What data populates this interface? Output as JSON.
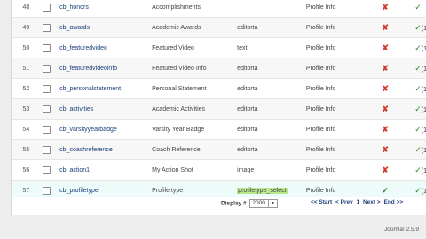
{
  "rows": [
    {
      "id": "48",
      "name": "cb_honors",
      "title": "Accomplishments",
      "type": "",
      "tab": "Profile Info",
      "required": "x",
      "published_num": ""
    },
    {
      "id": "49",
      "name": "cb_awards",
      "title": "Academic Awards",
      "type": "editorta",
      "tab": "Profile Info",
      "required": "x",
      "published_num": "(1"
    },
    {
      "id": "50",
      "name": "cb_featuredvideo",
      "title": "Featured Video",
      "type": "text",
      "tab": "Profile Info",
      "required": "x",
      "published_num": "(1"
    },
    {
      "id": "51",
      "name": "cb_featuredvideoinfo",
      "title": "Featured Video Info",
      "type": "editorta",
      "tab": "Profile Info",
      "required": "x",
      "published_num": "(1"
    },
    {
      "id": "52",
      "name": "cb_personalstatement",
      "title": "Personal Statement",
      "type": "editorta",
      "tab": "Profile Info",
      "required": "x",
      "published_num": "(1"
    },
    {
      "id": "53",
      "name": "cb_activities",
      "title": "Academic Activities",
      "type": "editorta",
      "tab": "Profile Info",
      "required": "x",
      "published_num": "(1"
    },
    {
      "id": "54",
      "name": "cb_varsityyearbadge",
      "title": "Varsity Year Badge",
      "type": "editorta",
      "tab": "Profile Info",
      "required": "x",
      "published_num": "(1"
    },
    {
      "id": "55",
      "name": "cb_coachreference",
      "title": "Coach Reference",
      "type": "editorta",
      "tab": "Profile Info",
      "required": "x",
      "published_num": "(1"
    },
    {
      "id": "56",
      "name": "cb_action1",
      "title": "My Action Shot",
      "type": "image",
      "tab": "Profile Info",
      "required": "x",
      "published_num": "(1"
    },
    {
      "id": "57",
      "name": "cb_profiletype",
      "title": "Profile type",
      "type": "profiletype_select",
      "tab": "Profile Info",
      "required": "check",
      "published_num": "(1"
    }
  ],
  "footer": {
    "display_label": "Display #",
    "display_value": "2000",
    "pager": [
      "<< Start",
      "< Prev",
      "1",
      "Next >",
      "End >>"
    ]
  },
  "version": "Joomla! 2.5.9",
  "colors": {
    "link": "#1a3f7a",
    "cross": "#d23b2b",
    "check": "#2e8b2e",
    "highlight": "#b9e88f"
  }
}
